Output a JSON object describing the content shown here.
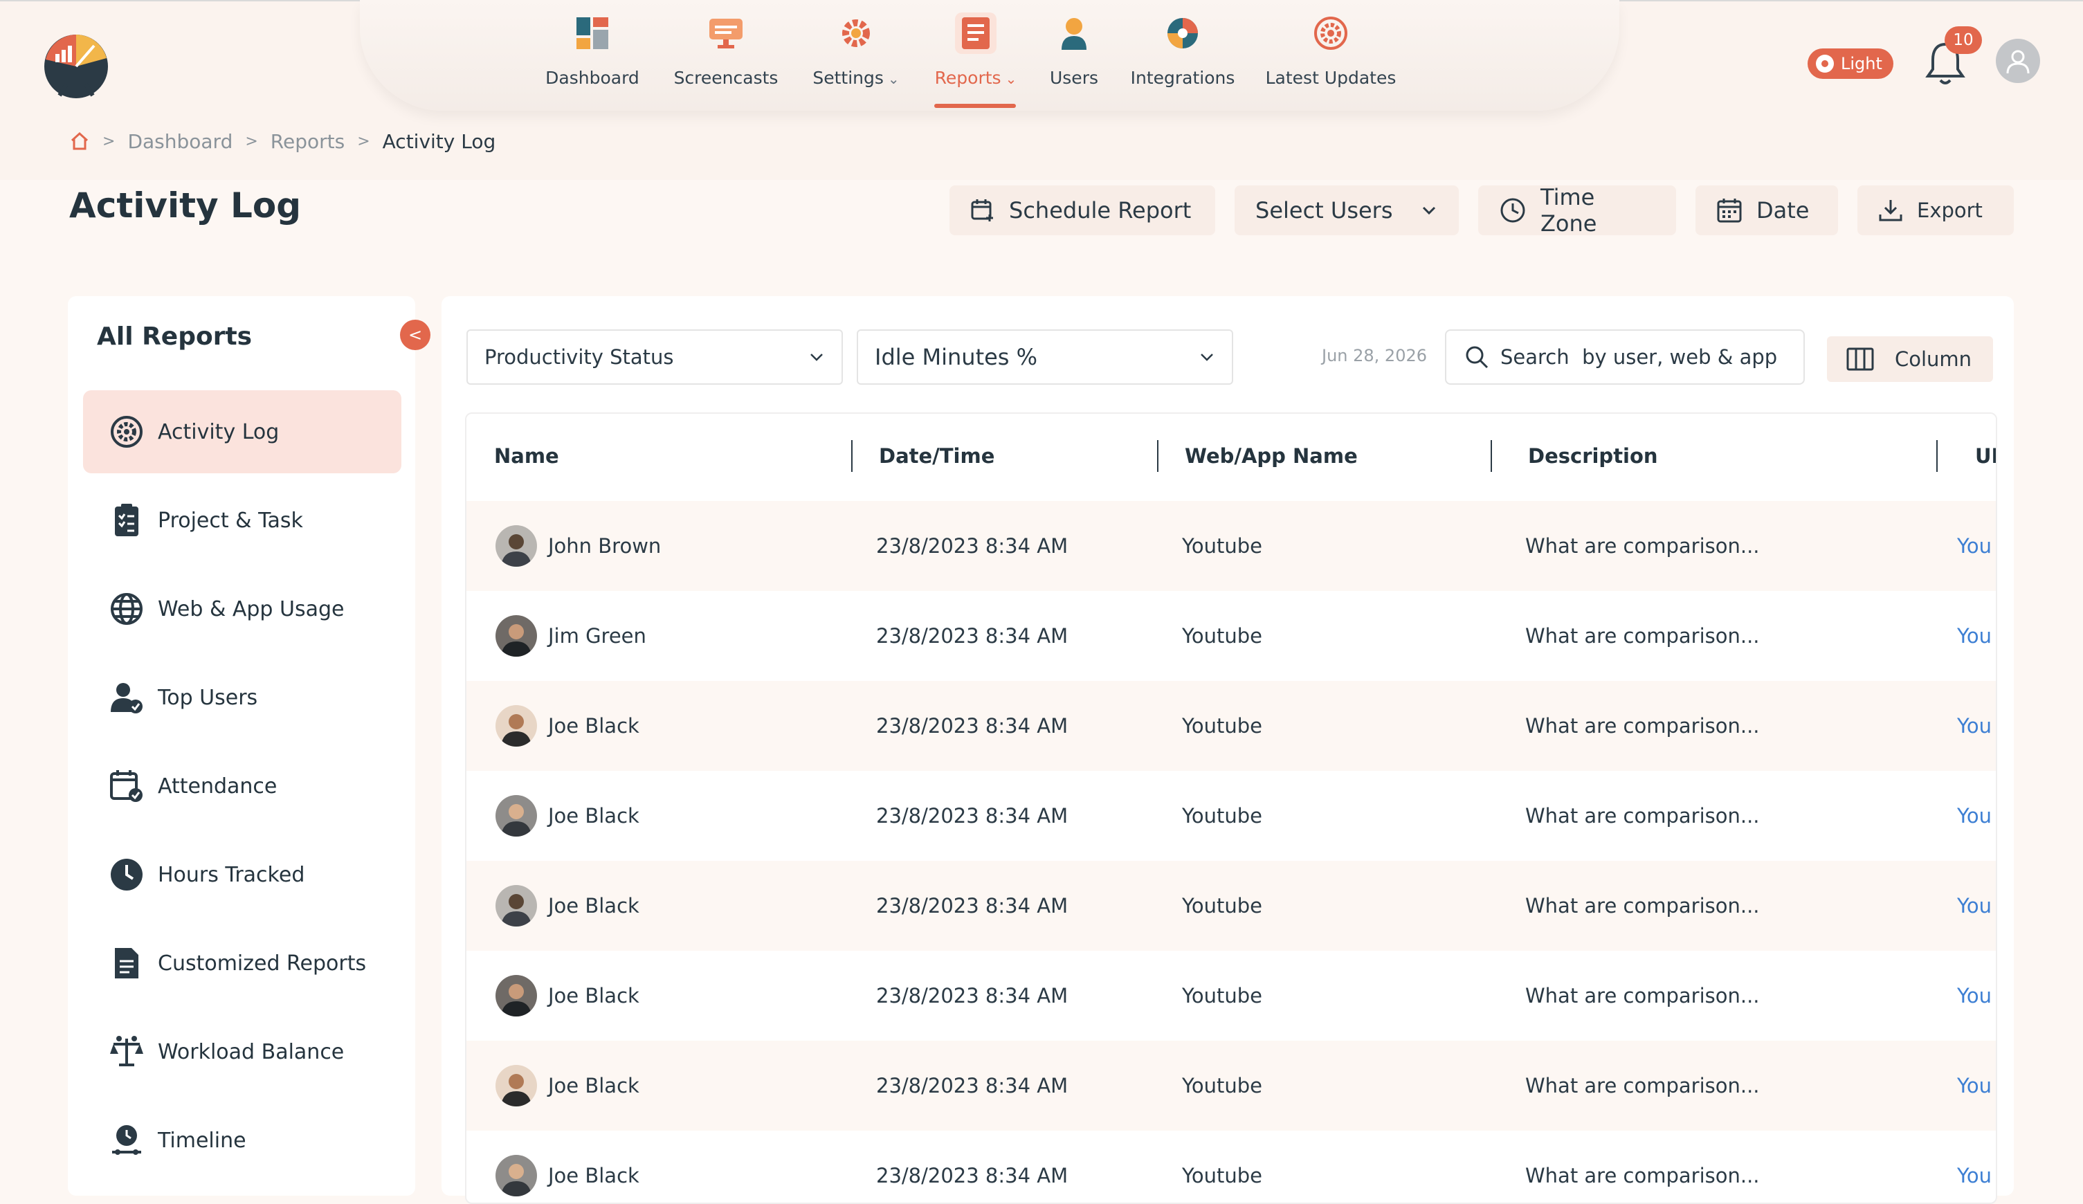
{
  "colors": {
    "accent": "#e2674c",
    "link": "#3d7fd3",
    "active_bg": "#fbe3dd"
  },
  "nav": {
    "items": [
      {
        "label": "Dashboard",
        "icon": "dashboard-icon"
      },
      {
        "label": "Screencasts",
        "icon": "screencast-icon"
      },
      {
        "label": "Settings",
        "icon": "settings-icon"
      },
      {
        "label": "Reports",
        "icon": "reports-icon",
        "active": true
      },
      {
        "label": "Users",
        "icon": "users-icon"
      },
      {
        "label": "Integrations",
        "icon": "integrations-icon"
      },
      {
        "label": "Latest Updates",
        "icon": "latest-updates-icon"
      }
    ],
    "theme_label": "Light",
    "notification_count": "10"
  },
  "breadcrumb": {
    "items": [
      "Dashboard",
      "Reports",
      "Activity Log"
    ]
  },
  "page": {
    "title": "Activity Log"
  },
  "toolbar": {
    "schedule_report": "Schedule Report",
    "select_users": "Select Users",
    "time_zone": "Time Zone",
    "date": "Date",
    "export": "Export"
  },
  "sidebar": {
    "title": "All Reports",
    "items": [
      {
        "label": "Activity Log",
        "icon": "activity-log-icon",
        "active": true
      },
      {
        "label": "Project & Task",
        "icon": "clipboard-icon"
      },
      {
        "label": "Web & App Usage",
        "icon": "globe-icon"
      },
      {
        "label": "Top Users",
        "icon": "top-users-icon"
      },
      {
        "label": "Attendance",
        "icon": "calendar-check-icon"
      },
      {
        "label": "Hours Tracked",
        "icon": "clock-icon"
      },
      {
        "label": "Customized Reports",
        "icon": "document-icon"
      },
      {
        "label": "Workload Balance",
        "icon": "balance-icon"
      },
      {
        "label": "Timeline",
        "icon": "timeline-icon"
      }
    ]
  },
  "filters": {
    "productivity_status": "Productivity Status",
    "idle_minutes": "Idle Minutes %",
    "date": "Jun 28, 2026",
    "search_placeholder": "Search  by user, web & app",
    "column_label": "Column"
  },
  "table": {
    "columns": [
      "Name",
      "Date/Time",
      "Web/App Name",
      "Description",
      "URL"
    ],
    "rows": [
      {
        "name": "John Brown",
        "datetime": "23/8/2023 8:34 AM",
        "app": "Youtube",
        "description": "What are comparison...",
        "url": "You"
      },
      {
        "name": "Jim Green",
        "datetime": "23/8/2023 8:34 AM",
        "app": "Youtube",
        "description": "What are comparison...",
        "url": "You"
      },
      {
        "name": "Joe Black",
        "datetime": "23/8/2023 8:34 AM",
        "app": "Youtube",
        "description": "What are comparison...",
        "url": "You"
      },
      {
        "name": "Joe Black",
        "datetime": "23/8/2023 8:34 AM",
        "app": "Youtube",
        "description": "What are comparison...",
        "url": "You"
      },
      {
        "name": "Joe Black",
        "datetime": "23/8/2023 8:34 AM",
        "app": "Youtube",
        "description": "What are comparison...",
        "url": "You"
      },
      {
        "name": "Joe Black",
        "datetime": "23/8/2023 8:34 AM",
        "app": "Youtube",
        "description": "What are comparison...",
        "url": "You"
      },
      {
        "name": "Joe Black",
        "datetime": "23/8/2023 8:34 AM",
        "app": "Youtube",
        "description": "What are comparison...",
        "url": "You"
      },
      {
        "name": "Joe Black",
        "datetime": "23/8/2023 8:34 AM",
        "app": "Youtube",
        "description": "What are comparison...",
        "url": "You"
      }
    ]
  }
}
